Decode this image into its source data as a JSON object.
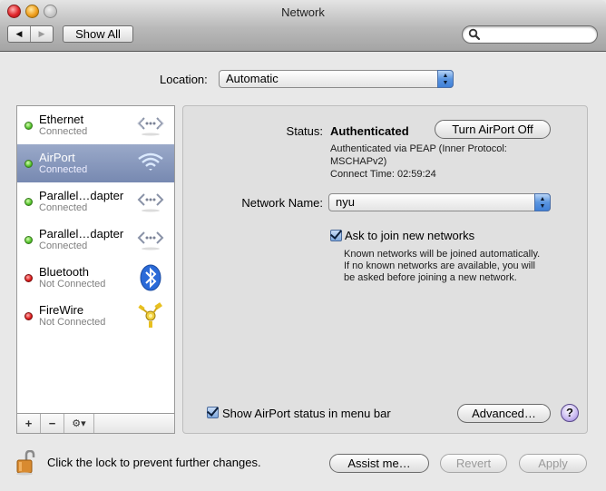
{
  "window": {
    "title": "Network",
    "back_label": "◀",
    "forward_label": "▶",
    "show_all_label": "Show All",
    "search_placeholder": ""
  },
  "location": {
    "label": "Location:",
    "value": "Automatic"
  },
  "services": [
    {
      "name": "Ethernet",
      "status": "Connected",
      "state": "green",
      "icon": "ethernet-icon",
      "selected": false
    },
    {
      "name": "AirPort",
      "status": "Connected",
      "state": "green",
      "icon": "wifi-icon",
      "selected": true
    },
    {
      "name": "Parallel…dapter",
      "status": "Connected",
      "state": "green",
      "icon": "ethernet-icon",
      "selected": false
    },
    {
      "name": "Parallel…dapter",
      "status": "Connected",
      "state": "green",
      "icon": "ethernet-icon",
      "selected": false
    },
    {
      "name": "Bluetooth",
      "status": "Not Connected",
      "state": "red",
      "icon": "bluetooth-icon",
      "selected": false
    },
    {
      "name": "FireWire",
      "status": "Not Connected",
      "state": "red",
      "icon": "firewire-icon",
      "selected": false
    }
  ],
  "sidebar_toolbar": {
    "add": "+",
    "remove": "−",
    "gear": "⚙▾"
  },
  "detail": {
    "status_label": "Status:",
    "status_value": "Authenticated",
    "turn_off_label": "Turn AirPort Off",
    "status_detail_line1": "Authenticated via PEAP (Inner Protocol:",
    "status_detail_line2": "MSCHAPv2)",
    "connect_time": "Connect Time: 02:59:24",
    "network_name_label": "Network Name:",
    "network_name_value": "nyu",
    "ask_join_label": "Ask to join new networks",
    "ask_join_checked": true,
    "ask_join_help_line1": "Known networks will be joined automatically.",
    "ask_join_help_line2": "If no known networks are available, you will",
    "ask_join_help_line3": "be asked before joining a new network.",
    "show_status_label": "Show AirPort status in menu bar",
    "show_status_checked": true,
    "advanced_label": "Advanced…",
    "help_label": "?"
  },
  "footer": {
    "lock_text": "Click the lock to prevent further changes.",
    "assist_label": "Assist me…",
    "revert_label": "Revert",
    "apply_label": "Apply"
  }
}
